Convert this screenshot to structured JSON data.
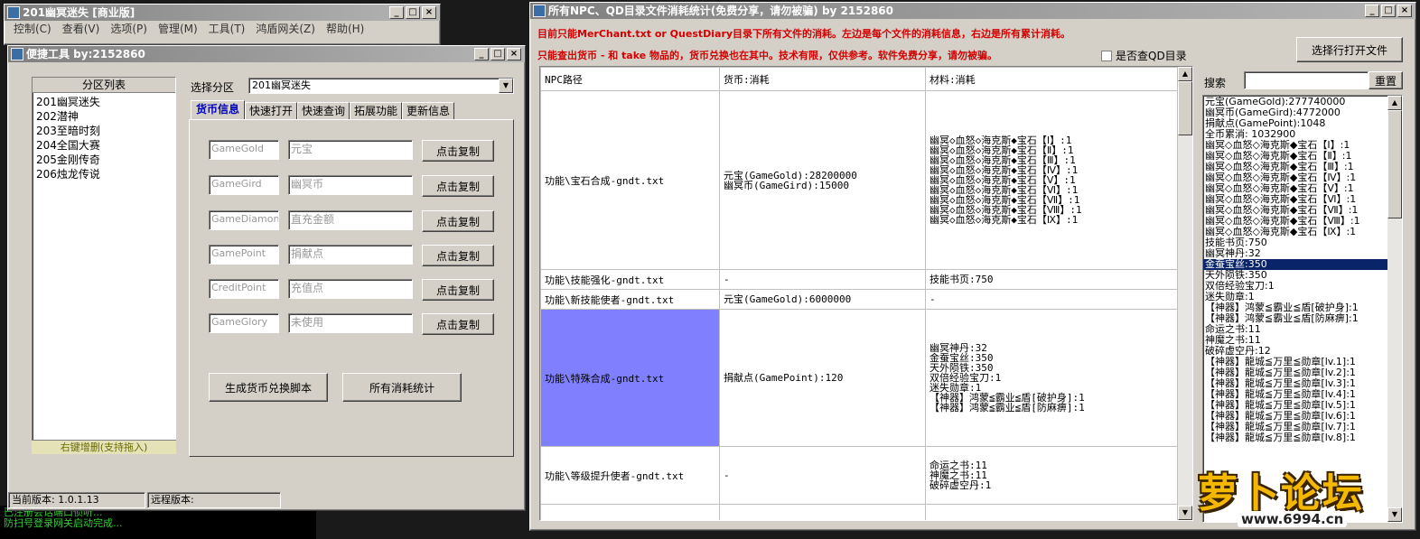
{
  "left_window": {
    "title": "201幽冥迷失 [商业版]",
    "menu": [
      "控制(C)",
      "查看(V)",
      "选项(P)",
      "管理(M)",
      "工具(T)",
      "鸿盾网关(Z)",
      "帮助(H)"
    ]
  },
  "tool_window": {
    "title": "便捷工具  by:2152860",
    "partition_list_header": "分区列表",
    "partitions": [
      "201幽冥迷失",
      "202潜神",
      "203至暗时刻",
      "204全国大赛",
      "205金刚传奇",
      "206烛龙传说"
    ],
    "footer_hint": "右键增删(支持拖入)",
    "select_label": "选择分区",
    "select_value": "201幽冥迷失",
    "tabs": [
      "货币信息",
      "快速打开",
      "快速查询",
      "拓展功能",
      "更新信息"
    ],
    "currency_rows": [
      {
        "code": "GameGold",
        "name": "元宝",
        "button": "点击复制"
      },
      {
        "code": "GameGird",
        "name": "幽冥币",
        "button": "点击复制"
      },
      {
        "code": "GameDiamond",
        "name": "直充金额",
        "button": "点击复制"
      },
      {
        "code": "GamePoint",
        "name": "捐献点",
        "button": "点击复制"
      },
      {
        "code": "CreditPoint",
        "name": "充值点",
        "button": "点击复制"
      },
      {
        "code": "GameGlory",
        "name": "未使用",
        "button": "点击复制"
      }
    ],
    "gen_button": "生成货币兑换脚本",
    "stats_button": "所有消耗统计",
    "status_current": "当前版本: 1.0.1.13",
    "status_remote": "远程版本:"
  },
  "console_lines": [
    "已注册会话端口侦听...",
    "防扫号登录网关启动完成..."
  ],
  "stats_window": {
    "title": "所有NPC、QD目录文件消耗统计(免费分享，请勿被骗)      by 2152860",
    "notice1": "目前只能MerChant.txt or QuestDiary目录下所有文件的消耗。左边是每个文件的消耗信息，右边是所有累计消耗。",
    "notice2": "只能查出货币 - 和 take 物品的，货币兑换也在其中。技术有限，仅供参考。软件免费分享，请勿被骗。",
    "qd_checkbox": "是否查QD目录",
    "open_file_button": "选择行打开文件",
    "headers": [
      "NPC路径",
      "货币:消耗",
      "材料:消耗"
    ],
    "rows": [
      {
        "path": "功能\\宝石合成-gndt.txt",
        "currency": [
          "元宝(GameGold):28200000",
          "幽冥币(GameGird):15000"
        ],
        "materials": [
          "幽冥◇血怒◇海克斯◆宝石【Ⅰ】:1",
          "幽冥◇血怒◇海克斯◆宝石【Ⅱ】:1",
          "幽冥◇血怒◇海克斯◆宝石【Ⅲ】:1",
          "幽冥◇血怒◇海克斯◆宝石【Ⅳ】:1",
          "幽冥◇血怒◇海克斯◆宝石【Ⅴ】:1",
          "幽冥◇血怒◇海克斯◆宝石【Ⅵ】:1",
          "幽冥◇血怒◇海克斯◆宝石【Ⅶ】:1",
          "幽冥◇血怒◇海克斯◆宝石【Ⅷ】:1",
          "幽冥◇血怒◇海克斯◆宝石【Ⅸ】:1"
        ]
      },
      {
        "path": "功能\\技能强化-gndt.txt",
        "currency": [
          "-"
        ],
        "materials": [
          "技能书页:750"
        ]
      },
      {
        "path": "功能\\新技能使者-gndt.txt",
        "currency": [
          "元宝(GameGold):6000000"
        ],
        "materials": [
          "-"
        ]
      },
      {
        "path": "功能\\特殊合成-gndt.txt",
        "currency": [
          "捐献点(GamePoint):120"
        ],
        "materials": [
          "幽冥神丹:32",
          "金蚕宝丝:350",
          "天外陨铁:350",
          "双倍经验宝刀:1",
          "迷失勋章:1",
          "【神器】鸿蒙≦霸业≦盾[破护身]:1",
          "【神器】鸿蒙≦霸业≦盾[防麻痹]:1"
        ]
      },
      {
        "path": "功能\\等级提升使者-gndt.txt",
        "currency": [
          "-"
        ],
        "materials": [
          "命运之书:11",
          "神魔之书:11",
          "破碎虚空丹:1"
        ]
      }
    ],
    "search_label": "搜索",
    "search_value": "",
    "reset_button": "重置",
    "totals": [
      "元宝(GameGold):277740000",
      "幽冥币(GameGird):4772000",
      "捐献点(GamePoint):1048",
      "全币累消: 1032900",
      "幽冥◇血怒◇海克斯◆宝石【Ⅰ】:1",
      "幽冥◇血怒◇海克斯◆宝石【Ⅱ】:1",
      "幽冥◇血怒◇海克斯◆宝石【Ⅲ】:1",
      "幽冥◇血怒◇海克斯◆宝石【Ⅳ】:1",
      "幽冥◇血怒◇海克斯◆宝石【Ⅴ】:1",
      "幽冥◇血怒◇海克斯◆宝石【Ⅵ】:1",
      "幽冥◇血怒◇海克斯◆宝石【Ⅶ】:1",
      "幽冥◇血怒◇海克斯◆宝石【Ⅷ】:1",
      "幽冥◇血怒◇海克斯◆宝石【Ⅸ】:1",
      "技能书页:750",
      "幽冥神丹:32",
      "金蚕宝丝:350",
      "天外陨铁:350",
      "双倍经验宝刀:1",
      "迷失勋章:1",
      "【神器】鸿蒙≦霸业≦盾[破护身]:1",
      "【神器】鸿蒙≦霸业≦盾[防麻痹]:1",
      "命运之书:11",
      "神魔之书:11",
      "破碎虚空丹:12",
      "【神器】龍城≦万里≦勋章[lv.1]:1",
      "【神器】龍城≦万里≦勋章[lv.2]:1",
      "【神器】龍城≦万里≦勋章[lv.3]:1",
      "【神器】龍城≦万里≦勋章[lv.4]:1",
      "【神器】龍城≦万里≦勋章[lv.5]:1",
      "【神器】龍城≦万里≦勋章[lv.6]:1",
      "【神器】龍城≦万里≦勋章[lv.7]:1",
      "【神器】龍城≦万里≦勋章[lv.8]:1"
    ],
    "selected_total_index": 15
  },
  "watermark": {
    "brand": "萝卜论坛",
    "url": "www.6994.cn"
  },
  "colors": {
    "title_bar": "#808080",
    "highlight_row": "#8080ff",
    "selected_item": "#0a246a",
    "notice_red": "#d40000",
    "tab_active": "#0000c0"
  }
}
